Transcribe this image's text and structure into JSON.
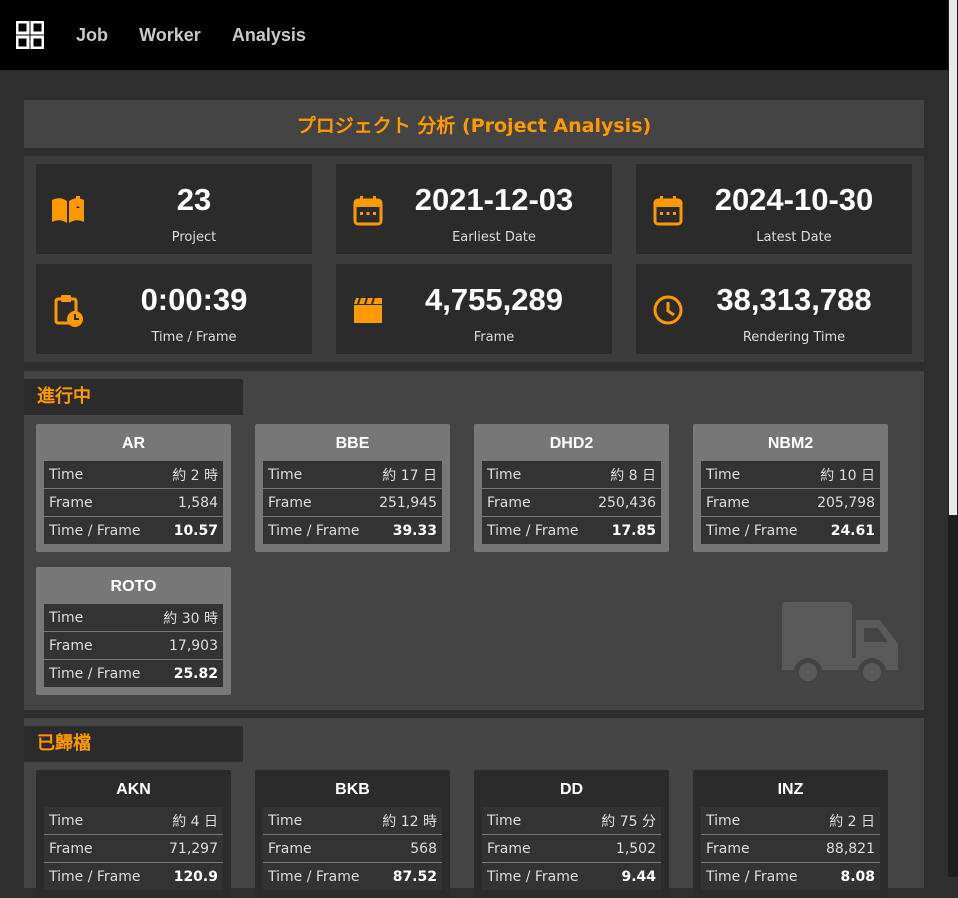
{
  "nav": {
    "logo_icon": "grid-icon",
    "items": [
      "Job",
      "Worker",
      "Analysis"
    ]
  },
  "page_title": "プロジェクト 分析 (Project Analysis)",
  "colors": {
    "accent": "#ff9900",
    "background": "#2e2e2e",
    "panel": "#444444",
    "card_active": "#777777",
    "card_dark": "#2b2b2b"
  },
  "stats": [
    {
      "icon": "book-open-icon",
      "value": "23",
      "label": "Project"
    },
    {
      "icon": "calendar-icon",
      "value": "2021-12-03",
      "label": "Earliest Date"
    },
    {
      "icon": "calendar-icon",
      "value": "2024-10-30",
      "label": "Latest Date"
    },
    {
      "icon": "clipboard-clock-icon",
      "value": "0:00:39",
      "label": "Time / Frame"
    },
    {
      "icon": "clapperboard-icon",
      "value": "4,755,289",
      "label": "Frame"
    },
    {
      "icon": "clock-icon",
      "value": "38,313,788",
      "label": "Rendering Time"
    }
  ],
  "row_labels": {
    "time": "Time",
    "frame": "Frame",
    "time_per_frame": "Time / Frame"
  },
  "in_progress": {
    "title": "進行中",
    "empty_icon": "truck-icon",
    "projects": [
      {
        "name": "AR",
        "time": "約 2 時",
        "frame": "1,584",
        "tpf": "10.57"
      },
      {
        "name": "BBE",
        "time": "約 17 日",
        "frame": "251,945",
        "tpf": "39.33"
      },
      {
        "name": "DHD2",
        "time": "約 8 日",
        "frame": "250,436",
        "tpf": "17.85"
      },
      {
        "name": "NBM2",
        "time": "約 10 日",
        "frame": "205,798",
        "tpf": "24.61"
      },
      {
        "name": "ROTO",
        "time": "約 30 時",
        "frame": "17,903",
        "tpf": "25.82"
      }
    ]
  },
  "archived": {
    "title": "已歸檔",
    "projects": [
      {
        "name": "AKN",
        "time": "約 4 日",
        "frame": "71,297",
        "tpf": "120.9"
      },
      {
        "name": "BKB",
        "time": "約 12 時",
        "frame": "568",
        "tpf": "87.52"
      },
      {
        "name": "DD",
        "time": "約 75 分",
        "frame": "1,502",
        "tpf": "9.44"
      },
      {
        "name": "INZ",
        "time": "約 2 日",
        "frame": "88,821",
        "tpf": "8.08"
      }
    ]
  }
}
